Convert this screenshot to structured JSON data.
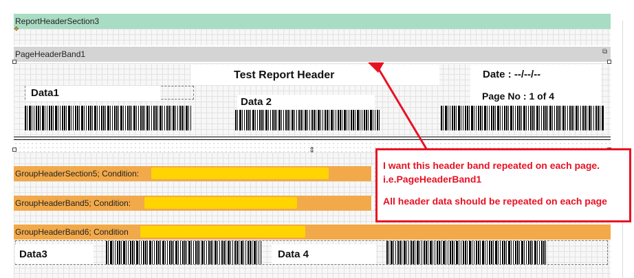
{
  "bands": {
    "report_header": "ReportHeaderSection3",
    "page_header": "PageHeaderBand1",
    "group_header_1": "GroupHeaderSection5; Condition:",
    "group_header_2": "GroupHeaderBand5; Condition:",
    "group_header_3": "GroupHeaderBand6; Condition"
  },
  "page_header": {
    "title": "Test Report Header",
    "date": "Date : --/--/--",
    "page_no": "Page No : 1 of 4",
    "data1": "Data1",
    "data2": "Data 2"
  },
  "detail": {
    "data3": "Data3",
    "data4": "Data 4"
  },
  "callout": {
    "line1": "I want this header band repeated on each page. i.e.PageHeaderBand1",
    "line2": "All header data should be repeated on each page"
  },
  "colors": {
    "report_header_band": "#a9dcc4",
    "page_header_band": "#d4d4d4",
    "group_header_band": "#f2a94a",
    "redaction": "#ffd400",
    "annotation": "#e81123"
  },
  "icons": {
    "band_resize": "band-resize-icon",
    "move_handle": "move-handle-icon"
  }
}
